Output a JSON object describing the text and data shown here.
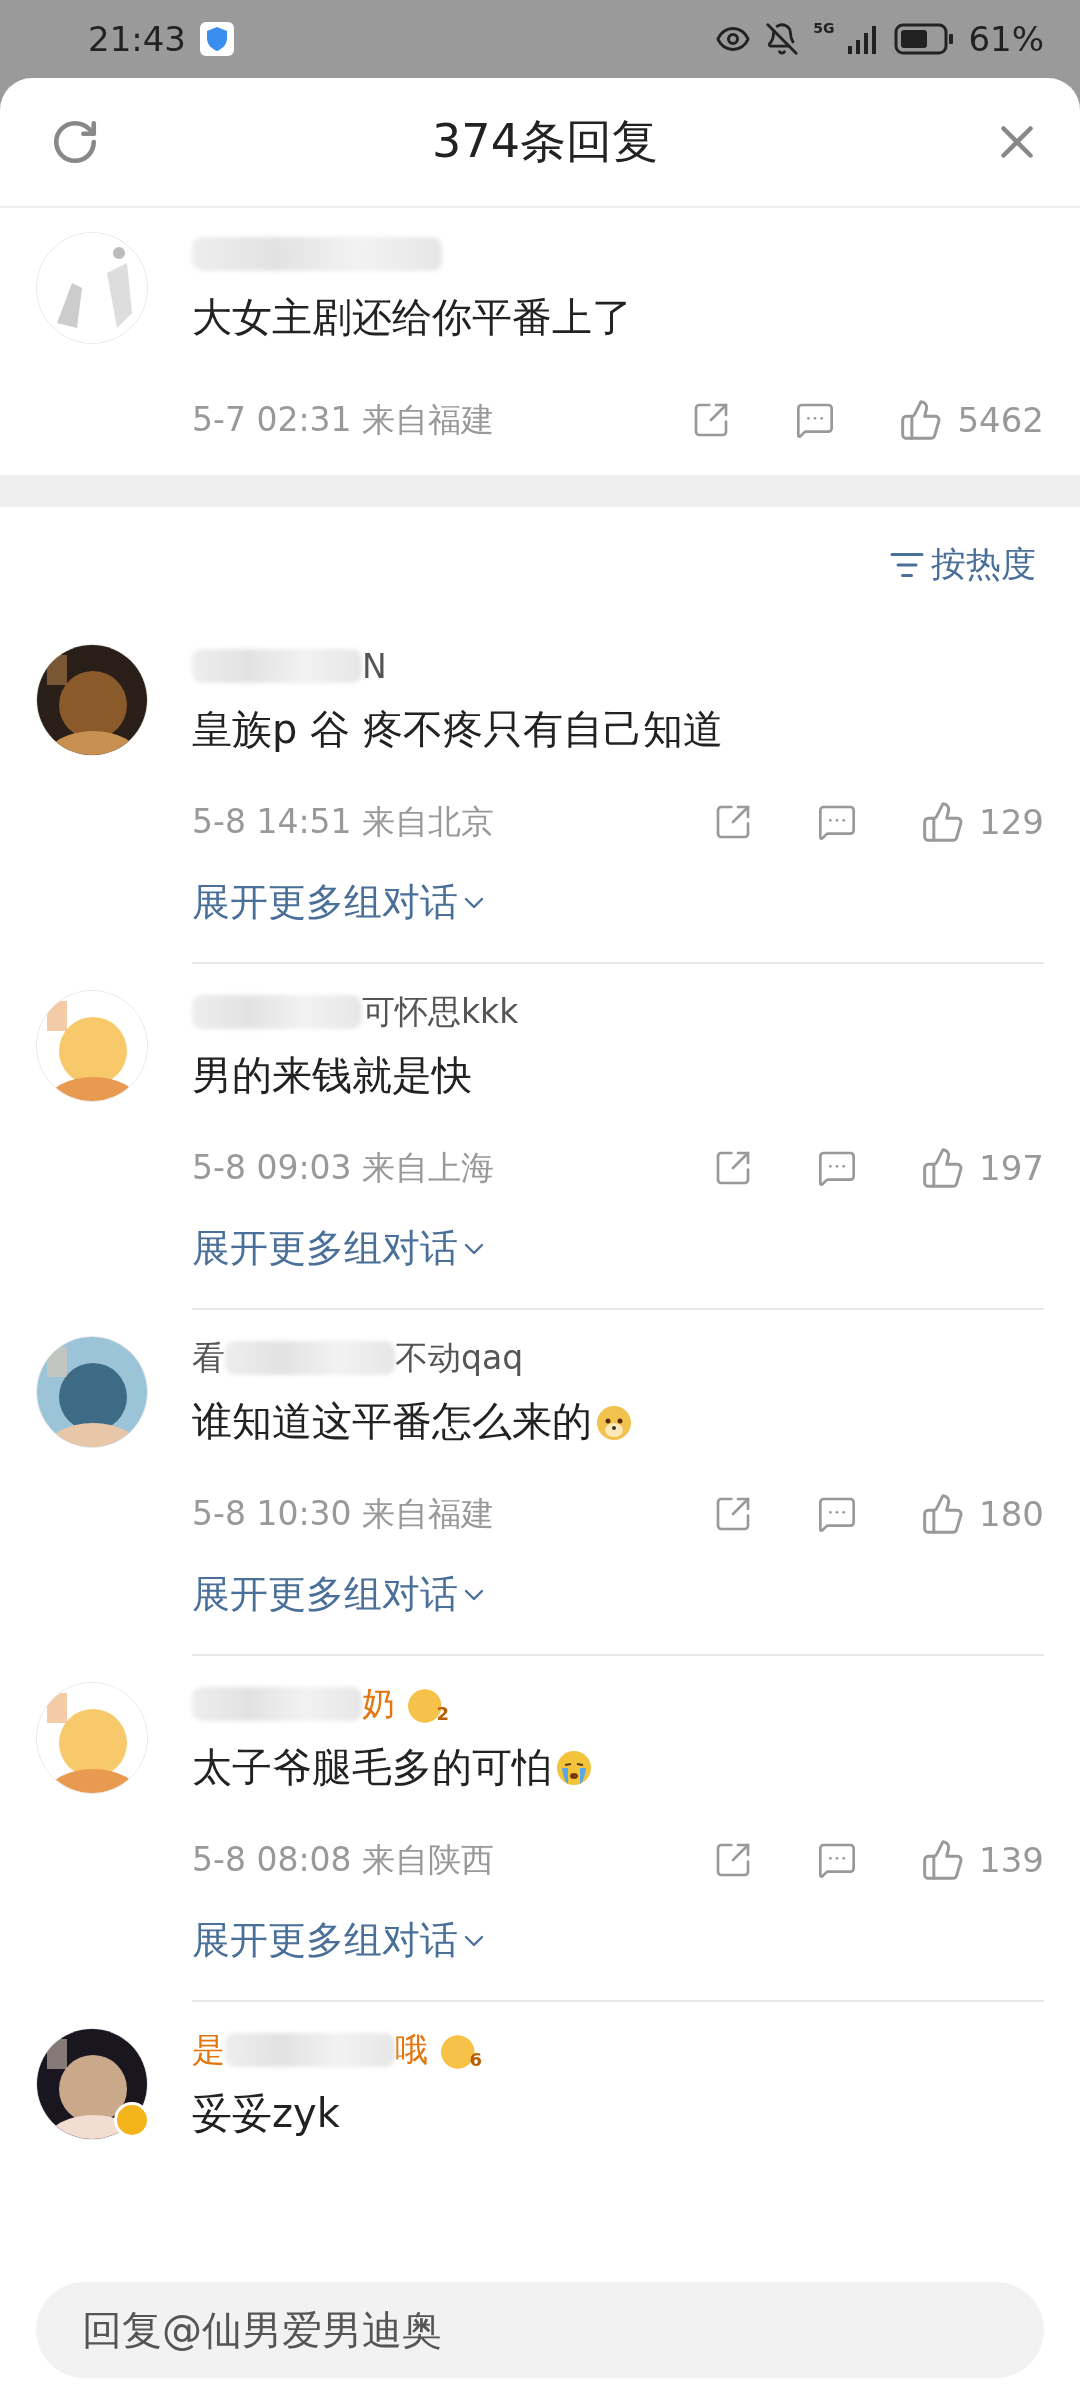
{
  "status_bar": {
    "time": "21:43",
    "battery": "61%",
    "network": "5G"
  },
  "header": {
    "title": "374条回复"
  },
  "main_comment": {
    "text": "大女主剧还给你平番上了",
    "time": "5-7 02:31",
    "location": "来自福建",
    "likes": "5462"
  },
  "sort": {
    "label": "按热度"
  },
  "comments": [
    {
      "name_parts": [
        "N"
      ],
      "vip": false,
      "text": "皇族p 谷 疼不疼只有自己知道",
      "time": "5-8 14:51",
      "location": "来自北京",
      "likes": "129",
      "expand": "展开更多组对话",
      "kind": "plain"
    },
    {
      "name_parts": [
        "可怀思kkk"
      ],
      "vip": false,
      "text": "男的来钱就是快",
      "time": "5-8 09:03",
      "location": "来自上海",
      "likes": "197",
      "expand": "展开更多组对话",
      "kind": "plain"
    },
    {
      "name_parts": [
        "看",
        "不动qaq"
      ],
      "vip": false,
      "text": "谁知道这平番怎么来的",
      "kind": "dog",
      "time": "5-8 10:30",
      "location": "来自福建",
      "likes": "180",
      "expand": "展开更多组对话"
    },
    {
      "name_parts": [
        "奶"
      ],
      "vip": true,
      "badge_level": "2",
      "text": "太子爷腿毛多的可怕",
      "kind": "crying",
      "time": "5-8 08:08",
      "location": "来自陕西",
      "likes": "139",
      "expand": "展开更多组对话"
    },
    {
      "name_parts": [
        "是",
        "哦"
      ],
      "vip": true,
      "badge_level": "6",
      "verified": true,
      "text": "妥妥zyk",
      "kind": "plain"
    }
  ],
  "reply_bar": {
    "placeholder": "回复@仙男爱男迪奥"
  }
}
